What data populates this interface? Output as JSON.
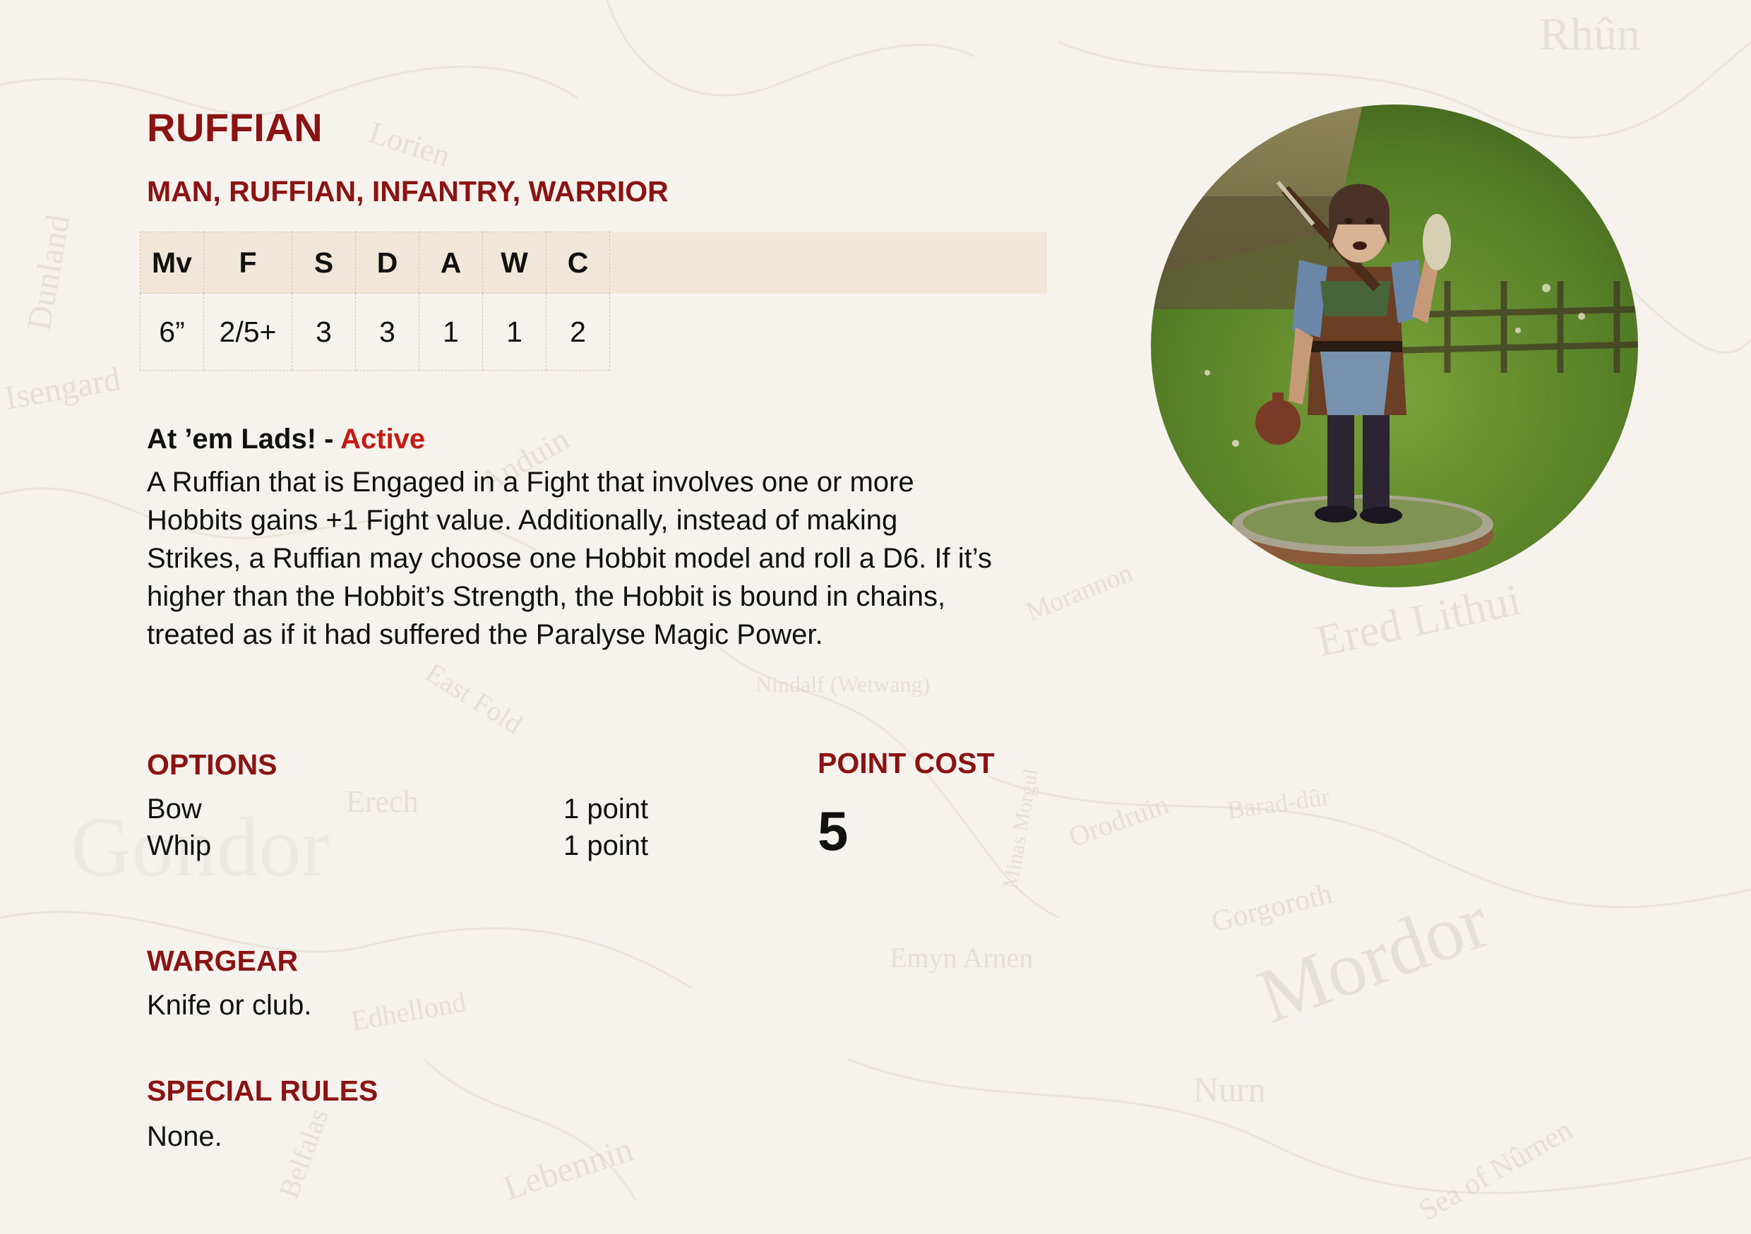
{
  "profile": {
    "name": "RUFFIAN",
    "keywords": "MAN, RUFFIAN, INFANTRY, WARRIOR"
  },
  "stats": {
    "headers": [
      "Mv",
      "F",
      "S",
      "D",
      "A",
      "W",
      "C"
    ],
    "values": [
      "6”",
      "2/5+",
      "3",
      "3",
      "1",
      "1",
      "2"
    ]
  },
  "special_ability": {
    "name": "At ’em Lads! - ",
    "type": "Active",
    "text": "A Ruffian that is Engaged in a Fight that involves one or more Hobbits gains +1 Fight value. Additionally, instead of making Strikes, a Ruffian may choose one Hobbit model and roll a D6. If it’s higher than the Hobbit’s Strength, the Hobbit is bound in chains, treated as if it had suffered the Paralyse Magic Power."
  },
  "options": {
    "title": "OPTIONS",
    "items": [
      {
        "name": "Bow",
        "cost": "1 point"
      },
      {
        "name": "Whip",
        "cost": "1 point"
      }
    ]
  },
  "point_cost": {
    "title": "POINT COST",
    "value": "5"
  },
  "wargear": {
    "title": "WARGEAR",
    "text": "Knife or club."
  },
  "special_rules": {
    "title": "SPECIAL RULES",
    "text": "None."
  },
  "map_labels": [
    "Rhûn",
    "Lorien",
    "Isengard",
    "Dunland",
    "Gondor",
    "Mordor",
    "Ered Lithui",
    "Nurn",
    "Emyn Arnen",
    "Barad-dûr",
    "Orodruin",
    "Gorgoroth",
    "Edhellond",
    "Lebennin",
    "Anduin",
    "Nindalf (Wetwang)",
    "Minas Morgul",
    "East Fold",
    "Morannon",
    "Erech",
    "Belfalas",
    "Sea of Nûrnen"
  ],
  "colors": {
    "accent_red": "#8b1313",
    "active_red": "#c41a12",
    "background": "#f6f3ee",
    "stat_header_bg": "#f1e7d8"
  }
}
